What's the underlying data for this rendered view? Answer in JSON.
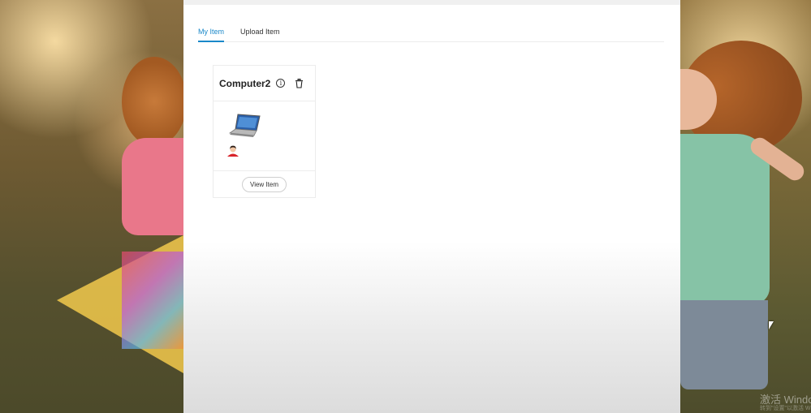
{
  "tabs": [
    {
      "label": "My Item",
      "active": true
    },
    {
      "label": "Upload Item",
      "active": false
    }
  ],
  "item_card": {
    "title": "Computer2",
    "view_button_label": "View Item",
    "icons": [
      "info-icon",
      "trash-icon",
      "laptop-image",
      "avatar"
    ]
  },
  "watermark": {
    "text": "激活 Windo",
    "subtext": "转到\"设置\"以激活 Windows"
  },
  "colors": {
    "accent": "#1a88c9",
    "brand": "#c2143a"
  }
}
